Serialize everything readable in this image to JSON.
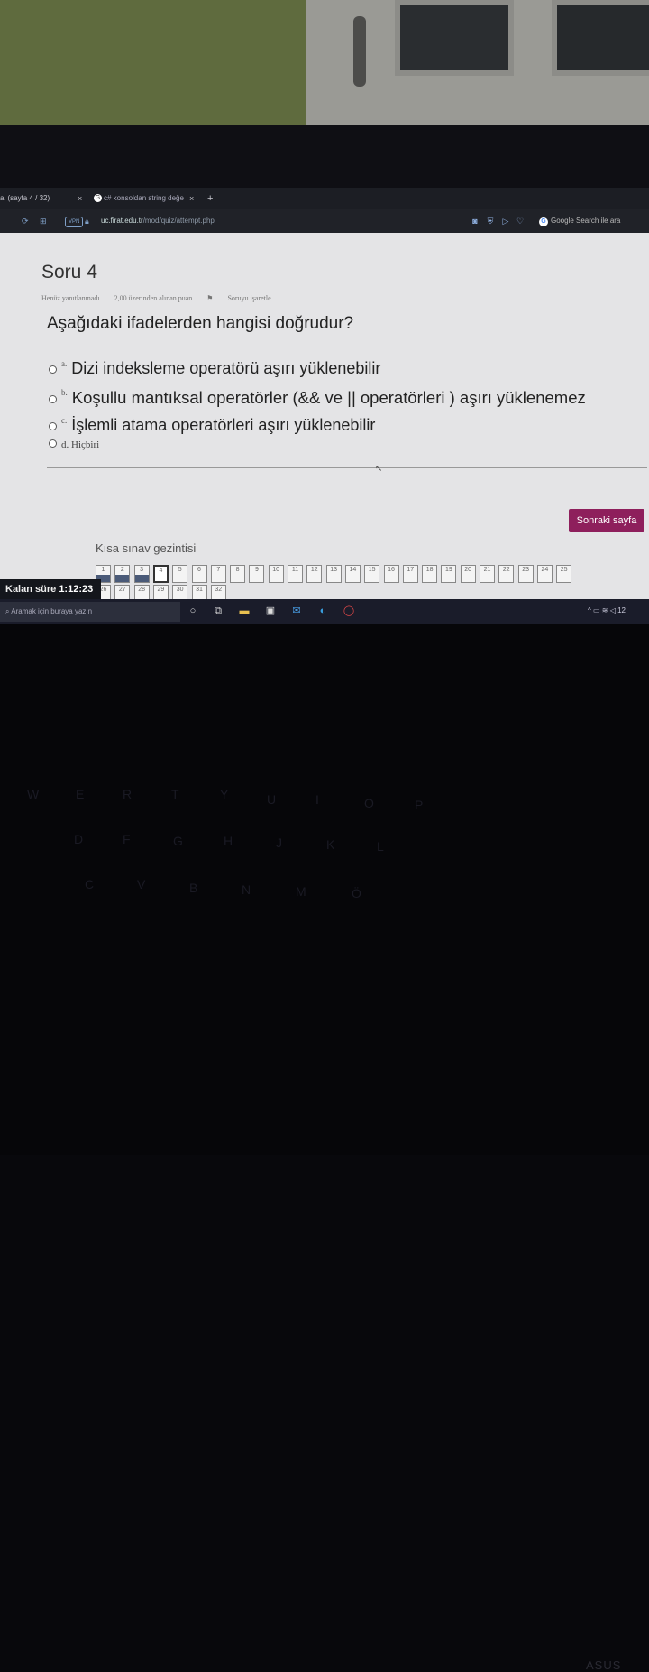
{
  "browser": {
    "tabs": [
      {
        "label": "al (sayfa 4 / 32)",
        "close": "×"
      },
      {
        "label": "c# konsoldan string değe",
        "close": "×",
        "favicon": "G"
      }
    ],
    "new_tab": "+",
    "vpn": "VPN",
    "url_host": "uc.firat.edu.tr",
    "url_path": "/mod/quiz/attempt.php",
    "search_engine_label": "Google Search ile ara"
  },
  "quiz": {
    "title": "Soru 4",
    "status": "Henüz yanıtlanmadı",
    "points": "2,00 üzerinden alınan puan",
    "flag_label": "Soruyu işaretle",
    "question": "Aşağıdaki ifadelerden hangisi doğrudur?",
    "options": [
      {
        "letter": "a.",
        "text": "Dizi indeksleme operatörü aşırı yüklenebilir"
      },
      {
        "letter": "b.",
        "text": "Koşullu mantıksal operatörler (&& ve || operatörleri ) aşırı yüklenemez"
      },
      {
        "letter": "c.",
        "text": "İşlemli atama operatörleri aşırı yüklenebilir"
      },
      {
        "letter": "",
        "text": "d. Hiçbiri"
      }
    ],
    "next_button": "Sonraki sayfa",
    "nav_title": "Kısa sınav gezintisi",
    "nav_numbers": [
      "1",
      "2",
      "3",
      "4",
      "5",
      "6",
      "7",
      "8",
      "9",
      "10",
      "11",
      "12",
      "13",
      "14",
      "15",
      "16",
      "17",
      "18",
      "19",
      "20",
      "21",
      "22",
      "23",
      "24",
      "25",
      "26",
      "27",
      "28",
      "29",
      "30",
      "31",
      "32"
    ],
    "answered_count": 3,
    "current_question": 4
  },
  "timer": {
    "label": "Kalan süre",
    "value": "1:12:23"
  },
  "taskbar": {
    "search_placeholder": "Aramak için buraya yazın",
    "clock": "12"
  },
  "keyboard": {
    "brand": "ASUS"
  },
  "colors": {
    "next_button_bg": "#8e1f5c",
    "page_bg": "#e4e4e6",
    "answered_box": "#4a5a78"
  }
}
